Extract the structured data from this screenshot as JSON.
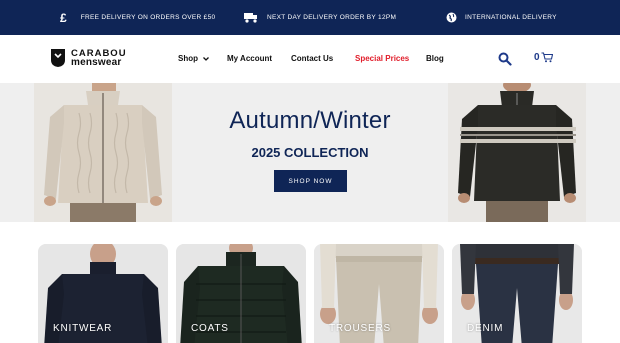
{
  "colors": {
    "navy": "#0f2556",
    "special_red": "#e11d2a",
    "cart_blue": "#1e3a8a"
  },
  "topbar": {
    "items": [
      {
        "icon": "pound-icon",
        "symbol": "£",
        "text": "FREE DELIVERY ON ORDERS OVER £50"
      },
      {
        "icon": "truck-icon",
        "text": "NEXT DAY DELIVERY ORDER BY 12PM"
      },
      {
        "icon": "globe-icon",
        "text": "INTERNATIONAL DELIVERY"
      }
    ]
  },
  "header": {
    "logo": {
      "line1": "CARABOU",
      "line2": "menswear"
    },
    "nav": [
      {
        "label": "Shop",
        "has_dropdown": true
      },
      {
        "label": "My Account"
      },
      {
        "label": "Contact Us"
      },
      {
        "label": "Special Prices"
      },
      {
        "label": "Blog"
      }
    ],
    "search_icon": "search-icon",
    "cart": {
      "count": "0",
      "icon": "cart-icon"
    }
  },
  "hero": {
    "title": "Autumn/Winter",
    "subtitle": "2025 COLLECTION",
    "button": "SHOP NOW"
  },
  "categories": [
    {
      "label": "KNITWEAR"
    },
    {
      "label": "COATS"
    },
    {
      "label": "TROUSERS"
    },
    {
      "label": "DENIM"
    }
  ]
}
